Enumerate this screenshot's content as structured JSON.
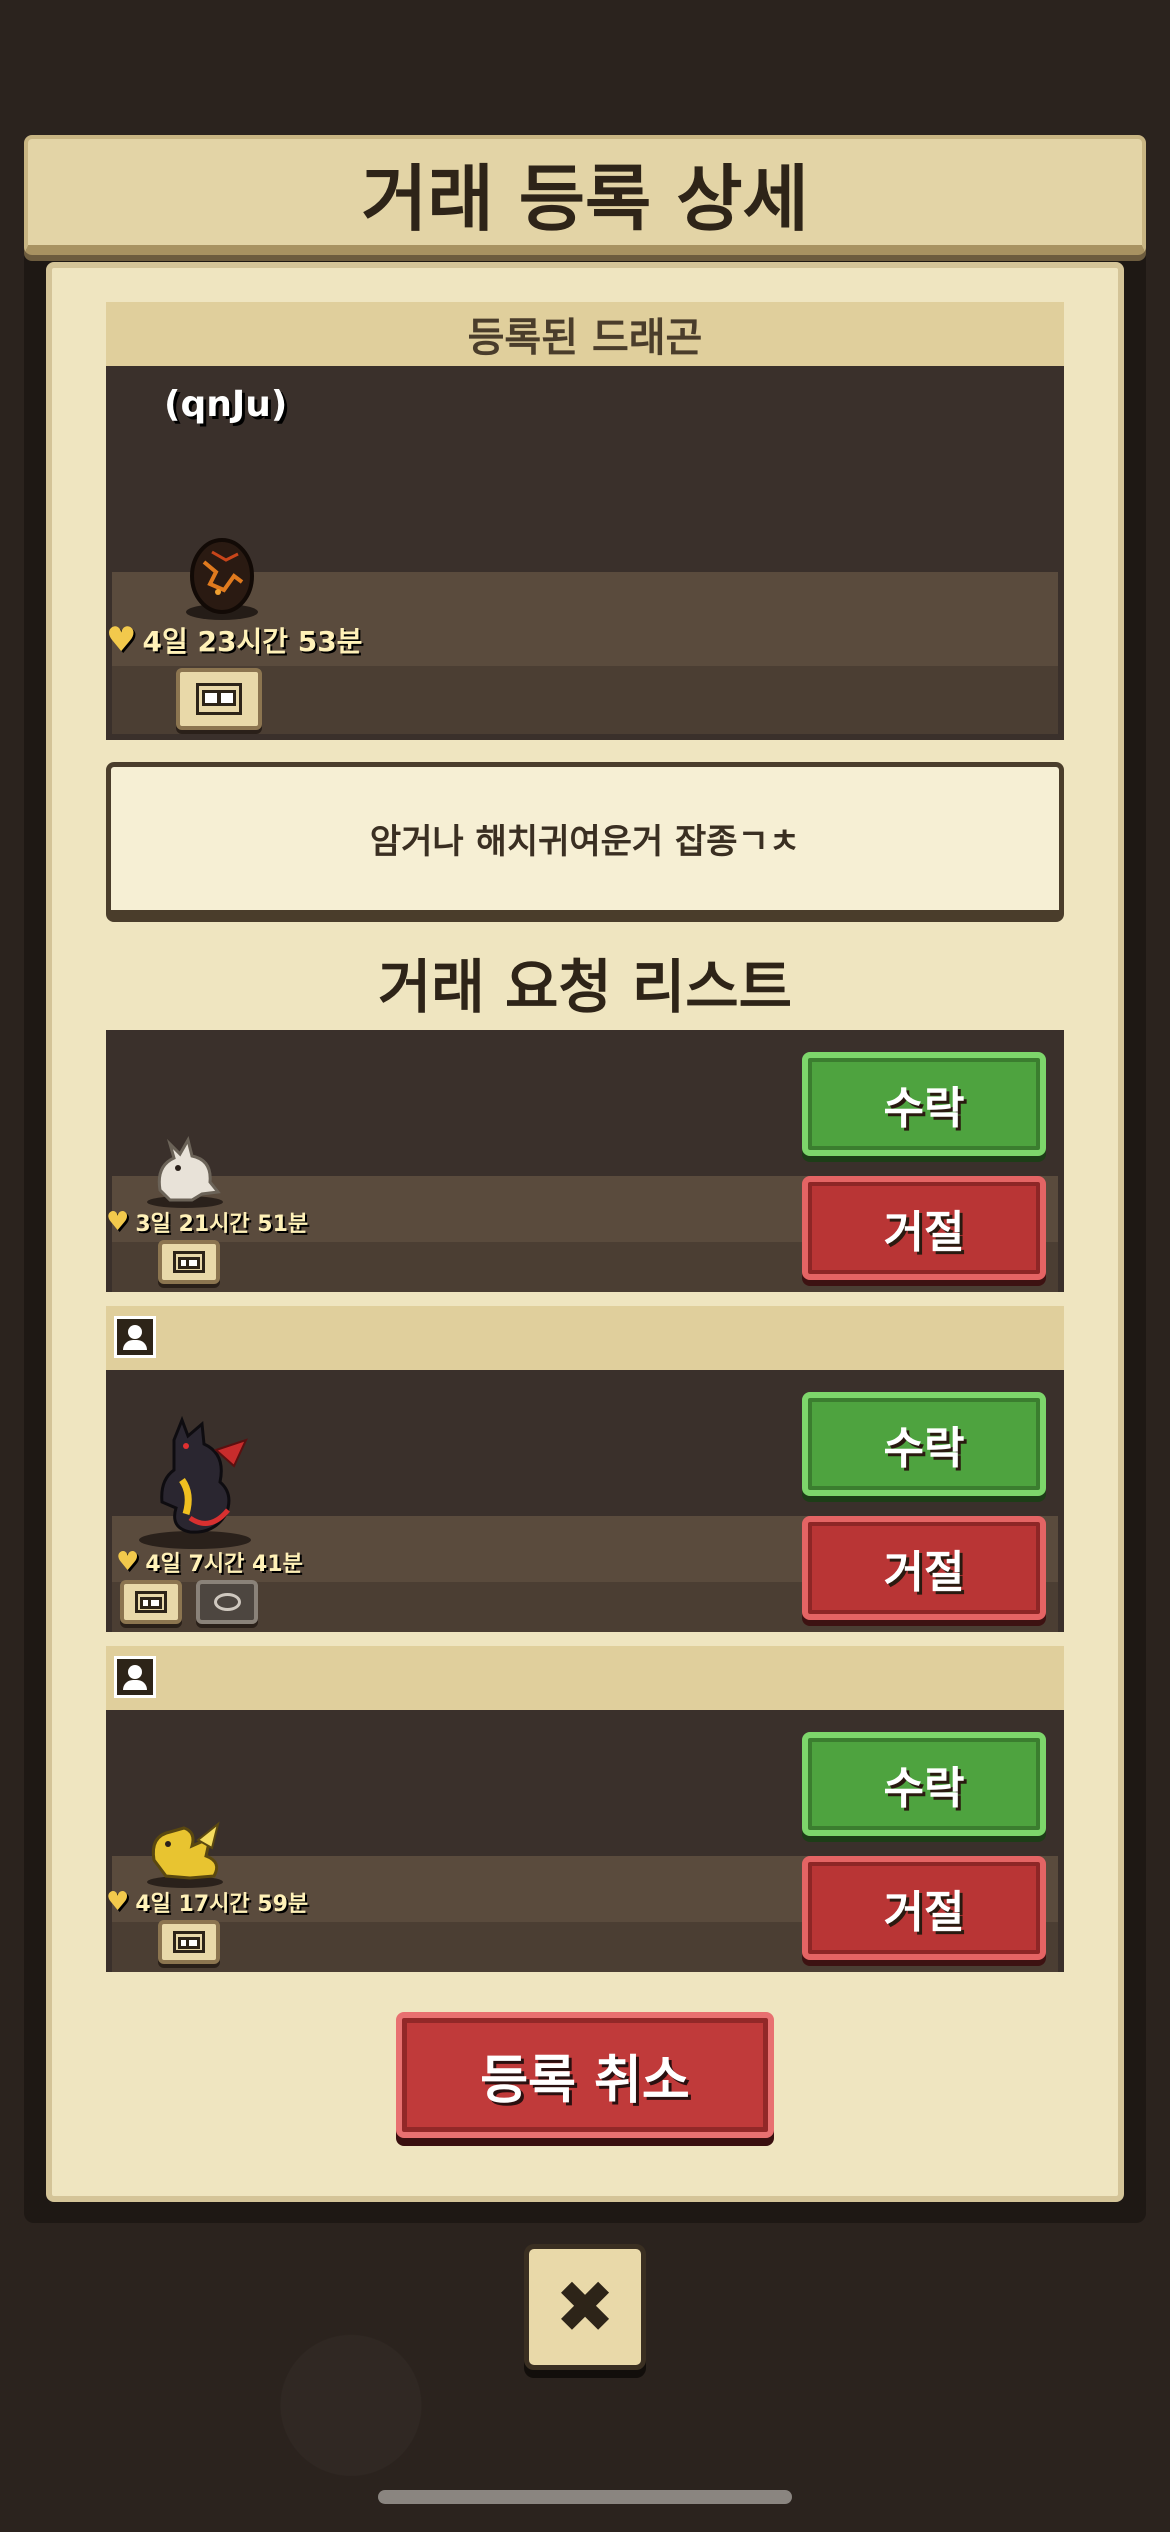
{
  "dialog": {
    "title": "거래 등록 상세"
  },
  "registered": {
    "section_label": "등록된 드래곤",
    "owner_name": "(qnJu)",
    "timer": "4일 23시간 53분",
    "sprite": "dragon-egg-icon",
    "memo": "암거나 해치귀여운거 잡종ㄱㅊ"
  },
  "requests": {
    "title": "거래 요청 리스트",
    "items": [
      {
        "timer": "3일 21시간 51분",
        "sprite": "white-dragon-icon",
        "accept_label": "수락",
        "reject_label": "거절"
      },
      {
        "timer": "4일 7시간 41분",
        "sprite": "black-red-dragon-icon",
        "accept_label": "수락",
        "reject_label": "거절"
      },
      {
        "timer": "4일 17시간 59분",
        "sprite": "yellow-dragon-icon",
        "accept_label": "수락",
        "reject_label": "거절"
      }
    ]
  },
  "footer": {
    "cancel_label": "등록 취소",
    "close_icon": "close-icon",
    "close_glyph": "✖"
  },
  "colors": {
    "accept": "#4ea33f",
    "reject": "#b93535",
    "panel": "#efe5c0",
    "dark_box": "#3a302b"
  }
}
